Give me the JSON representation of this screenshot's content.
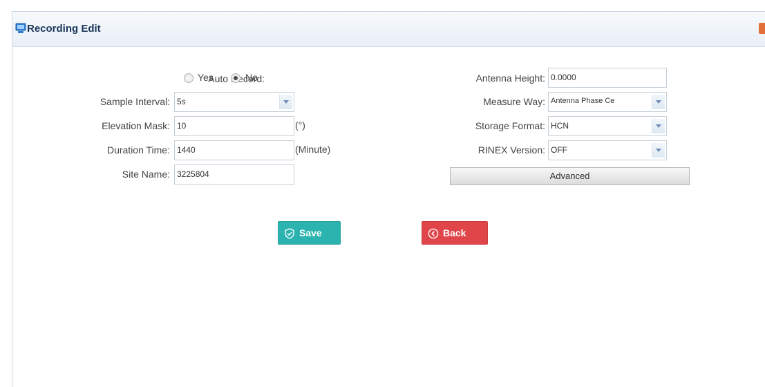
{
  "panel": {
    "title": "Recording Edit"
  },
  "form_left": {
    "auto_record": {
      "label": "Auto Record:",
      "options": [
        "Yes",
        "No"
      ],
      "selected": "No"
    },
    "sample_interval": {
      "label": "Sample Interval:",
      "value": "5s"
    },
    "elevation_mask": {
      "label": "Elevation Mask:",
      "value": "10",
      "unit": "(°)"
    },
    "duration_time": {
      "label": "Duration Time:",
      "value": "1440",
      "unit": "(Minute)"
    },
    "site_name": {
      "label": "Site Name:",
      "value": "3225804"
    }
  },
  "form_right": {
    "antenna_height": {
      "label": "Antenna Height:",
      "value": "0.0000"
    },
    "measure_way": {
      "label": "Measure Way:",
      "value": "Antenna Phase Ce"
    },
    "storage_format": {
      "label": "Storage Format:",
      "value": "HCN"
    },
    "rinex_version": {
      "label": "RINEX Version:",
      "value": "OFF"
    },
    "advanced_label": "Advanced"
  },
  "actions": {
    "save_label": "Save",
    "back_label": "Back"
  },
  "colors": {
    "save": "#2bb3b0",
    "back": "#e0454a",
    "title": "#1b3659"
  },
  "icons": {
    "title": "monitor-icon",
    "save": "check-shield-icon",
    "back": "back-arrow-icon",
    "dropdown": "chevron-down-icon"
  }
}
